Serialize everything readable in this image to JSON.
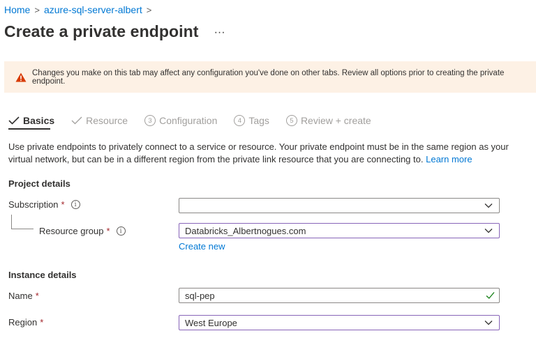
{
  "breadcrumb": {
    "home": "Home",
    "resource": "azure-sql-server-albert",
    "separator": ">"
  },
  "title": "Create a private endpoint",
  "more_label": "···",
  "warning": {
    "text": "Changes you make on this tab may affect any configuration you've done on other tabs. Review all options prior to creating the private endpoint.",
    "icon": "warning-icon",
    "color": "#d83b01",
    "background": "#fdf1e5"
  },
  "tabs": [
    {
      "label": "Basics",
      "state": "active",
      "marker": "check"
    },
    {
      "label": "Resource",
      "state": "inactive",
      "marker": "check"
    },
    {
      "label": "Configuration",
      "state": "inactive",
      "marker": "3"
    },
    {
      "label": "Tags",
      "state": "inactive",
      "marker": "4"
    },
    {
      "label": "Review + create",
      "state": "inactive",
      "marker": "5"
    }
  ],
  "description": {
    "text": "Use private endpoints to privately connect to a service or resource. Your private endpoint must be in the same region as your virtual network, but can be in a different region from the private link resource that you are connecting to.",
    "link": "Learn more"
  },
  "project_details": {
    "heading": "Project details",
    "subscription": {
      "label": "Subscription",
      "required": "*",
      "value": ""
    },
    "resource_group": {
      "label": "Resource group",
      "required": "*",
      "value": "Databricks_Albertnogues.com",
      "create_new": "Create new"
    }
  },
  "instance_details": {
    "heading": "Instance details",
    "name": {
      "label": "Name",
      "required": "*",
      "value": "sql-pep"
    },
    "region": {
      "label": "Region",
      "required": "*",
      "value": "West Europe"
    }
  },
  "colors": {
    "link": "#0078d4",
    "required": "#a4262c",
    "focus_border": "#8764b8",
    "valid_check": "#107c10"
  }
}
